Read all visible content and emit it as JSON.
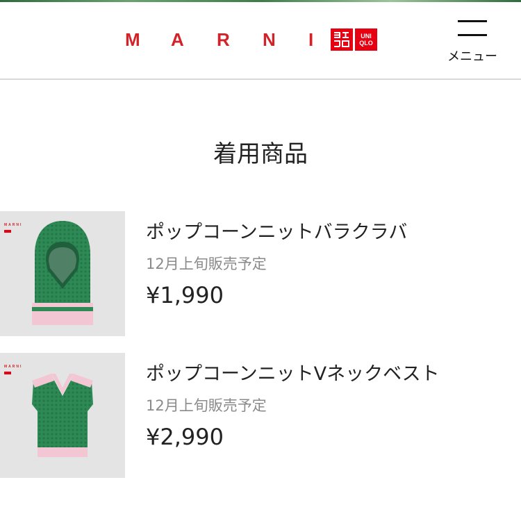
{
  "header": {
    "brand_marni": [
      "M",
      "A",
      "R",
      "N",
      "I"
    ],
    "uniqlo_box1": "ユニクロ",
    "uniqlo_box2": [
      "UNI",
      "QLO"
    ],
    "menu_label": "メニュー",
    "menu_icon": "hamburger-menu-icon"
  },
  "colors": {
    "marni_red": "#d2232a",
    "uniqlo_red": "#e60012",
    "knit_green": "#2e8a54",
    "pink": "#f2c6d3",
    "thumb_bg": "#e4e4e4"
  },
  "section": {
    "title": "着用商品"
  },
  "products": [
    {
      "name": "ポップコーンニットバラクラバ",
      "status": "12月上旬販売予定",
      "price": "¥1,990",
      "image": "balaclava-image"
    },
    {
      "name": "ポップコーンニットVネックベスト",
      "status": "12月上旬販売予定",
      "price": "¥2,990",
      "image": "vneck-vest-image"
    }
  ]
}
